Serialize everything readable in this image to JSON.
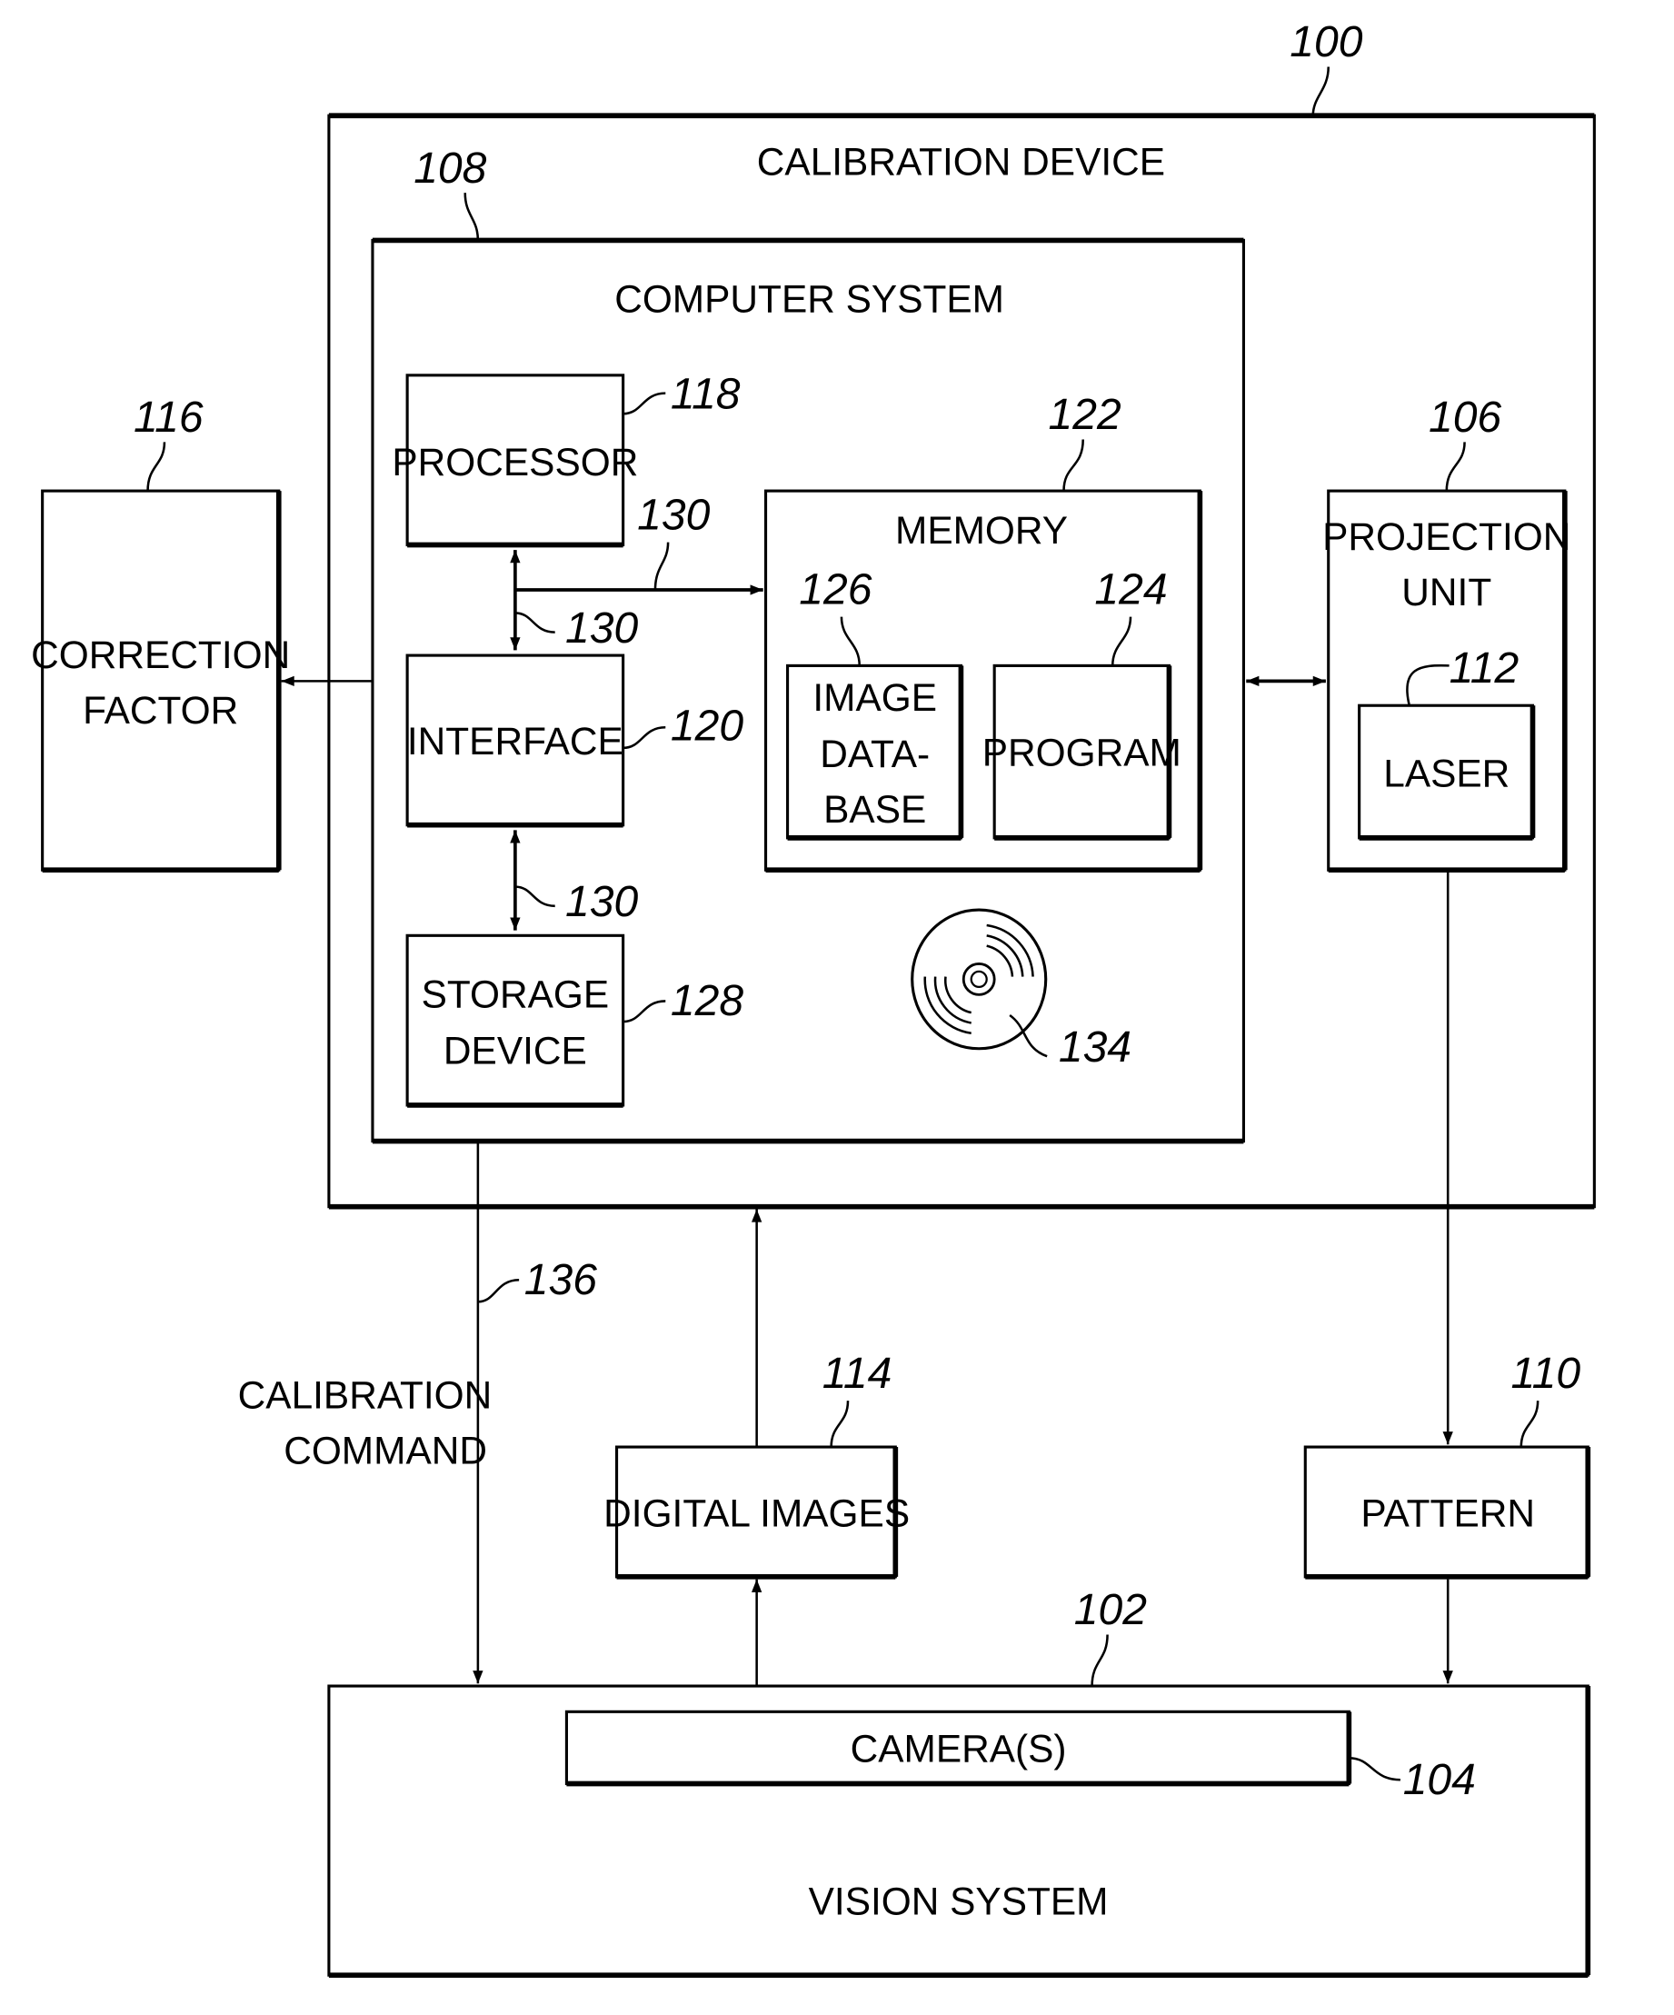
{
  "diagram": {
    "calibration_device": {
      "label": "CALIBRATION DEVICE",
      "ref": "100"
    },
    "computer_system": {
      "label": "COMPUTER SYSTEM",
      "ref": "108"
    },
    "processor": {
      "label": "PROCESSOR",
      "ref": "118"
    },
    "interface": {
      "label": "INTERFACE",
      "ref": "120"
    },
    "storage_device": {
      "label_line1": "STORAGE",
      "label_line2": "DEVICE",
      "ref": "128"
    },
    "memory": {
      "label": "MEMORY",
      "ref": "122"
    },
    "image_database": {
      "label_line1": "IMAGE",
      "label_line2": "DATA-",
      "label_line3": "BASE",
      "ref": "126"
    },
    "program": {
      "label": "PROGRAM",
      "ref": "124"
    },
    "disc": {
      "ref": "134",
      "icon": "optical-disc-icon"
    },
    "bus": {
      "ref": "130"
    },
    "correction_factor": {
      "label_line1": "CORRECTION",
      "label_line2": "FACTOR",
      "ref": "116"
    },
    "projection_unit": {
      "label_line1": "PROJECTION",
      "label_line2": "UNIT",
      "ref": "106"
    },
    "laser": {
      "label": "LASER",
      "ref": "112"
    },
    "calibration_command": {
      "label_line1": "CALIBRATION",
      "label_line2": "COMMAND",
      "ref": "136"
    },
    "digital_images": {
      "label": "DIGITAL IMAGES",
      "ref": "114"
    },
    "pattern": {
      "label": "PATTERN",
      "ref": "110"
    },
    "vision_system": {
      "label": "VISION SYSTEM",
      "ref": "102"
    },
    "cameras": {
      "label": "CAMERA(S)",
      "ref": "104"
    }
  }
}
